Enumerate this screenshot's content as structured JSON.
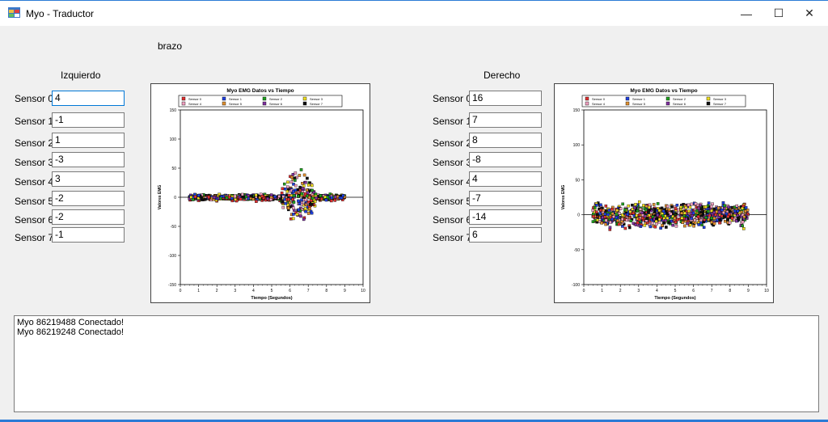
{
  "window": {
    "title": "Myo - Traductor",
    "controls": {
      "minimize": "—",
      "maximize": "☐",
      "close": "✕"
    }
  },
  "labels": {
    "arm": "brazo",
    "left": "Izquierdo",
    "right": "Derecho"
  },
  "left_sensors": [
    {
      "label": "Sensor 0",
      "value": "4"
    },
    {
      "label": "Sensor 1",
      "value": "-1"
    },
    {
      "label": "Sensor 2",
      "value": "1"
    },
    {
      "label": "Sensor 3",
      "value": "-3"
    },
    {
      "label": "Sensor 4",
      "value": "3"
    },
    {
      "label": "Sensor 5",
      "value": "-2"
    },
    {
      "label": "Sensor 6",
      "value": "-2"
    },
    {
      "label": "Sensor 7",
      "value": "-1"
    }
  ],
  "right_sensors": [
    {
      "label": "Sensor 0",
      "value": "16"
    },
    {
      "label": "Sensor 1",
      "value": "7"
    },
    {
      "label": "Sensor 2",
      "value": "8"
    },
    {
      "label": "Sensor 3",
      "value": "-8"
    },
    {
      "label": "Sensor 4",
      "value": "4"
    },
    {
      "label": "Sensor 5",
      "value": "-7"
    },
    {
      "label": "Sensor 6",
      "value": "-14"
    },
    {
      "label": "Sensor 7",
      "value": "6"
    }
  ],
  "log": {
    "lines": [
      "Myo 86219488 Conectado!",
      "Myo 86219248 Conectado!"
    ]
  },
  "chart_data": [
    {
      "type": "scatter",
      "title": "Myo EMG Datos vs Tiempo",
      "xlabel": "Tiempo (Segundos)",
      "ylabel": "Valores EMG",
      "xlim": [
        0,
        10
      ],
      "ylim": [
        -150,
        150
      ],
      "xticks": [
        0,
        1,
        2,
        3,
        4,
        5,
        6,
        7,
        8,
        9,
        10
      ],
      "yticks": [
        -150,
        -100,
        -50,
        0,
        50,
        100,
        150
      ],
      "legend_position": "top",
      "series": [
        {
          "name": "Sensor 0",
          "color": "#e03030"
        },
        {
          "name": "Sensor 1",
          "color": "#2040e0"
        },
        {
          "name": "Sensor 2",
          "color": "#20a020"
        },
        {
          "name": "Sensor 3",
          "color": "#f0e020"
        },
        {
          "name": "Sensor 4",
          "color": "#f0a0c0"
        },
        {
          "name": "Sensor 5",
          "color": "#e09030"
        },
        {
          "name": "Sensor 6",
          "color": "#8030a0"
        },
        {
          "name": "Sensor 7",
          "color": "#101010"
        }
      ],
      "activity": {
        "x_start": 0.5,
        "x_end": 9.0,
        "burst_start": 5.5,
        "burst_end": 7.4,
        "base_amp": 6,
        "burst_amp": 55,
        "seed": 3
      }
    },
    {
      "type": "scatter",
      "title": "Myo EMG Datos vs Tiempo",
      "xlabel": "Tiempo (Segundos)",
      "ylabel": "Valores EMG",
      "xlim": [
        0,
        10
      ],
      "ylim": [
        -100,
        150
      ],
      "xticks": [
        0,
        1,
        2,
        3,
        4,
        5,
        6,
        7,
        8,
        9,
        10
      ],
      "yticks": [
        -100,
        -50,
        0,
        50,
        100,
        150
      ],
      "legend_position": "top",
      "series": [
        {
          "name": "Sensor 0",
          "color": "#e03030"
        },
        {
          "name": "Sensor 1",
          "color": "#2040e0"
        },
        {
          "name": "Sensor 2",
          "color": "#20a020"
        },
        {
          "name": "Sensor 3",
          "color": "#f0e020"
        },
        {
          "name": "Sensor 4",
          "color": "#f0a0c0"
        },
        {
          "name": "Sensor 5",
          "color": "#e09030"
        },
        {
          "name": "Sensor 6",
          "color": "#8030a0"
        },
        {
          "name": "Sensor 7",
          "color": "#101010"
        }
      ],
      "activity": {
        "x_start": 0.5,
        "x_end": 9.0,
        "burst_start": 0.5,
        "burst_end": 9.0,
        "base_amp": 22,
        "burst_amp": 22,
        "seed": 11
      }
    }
  ]
}
